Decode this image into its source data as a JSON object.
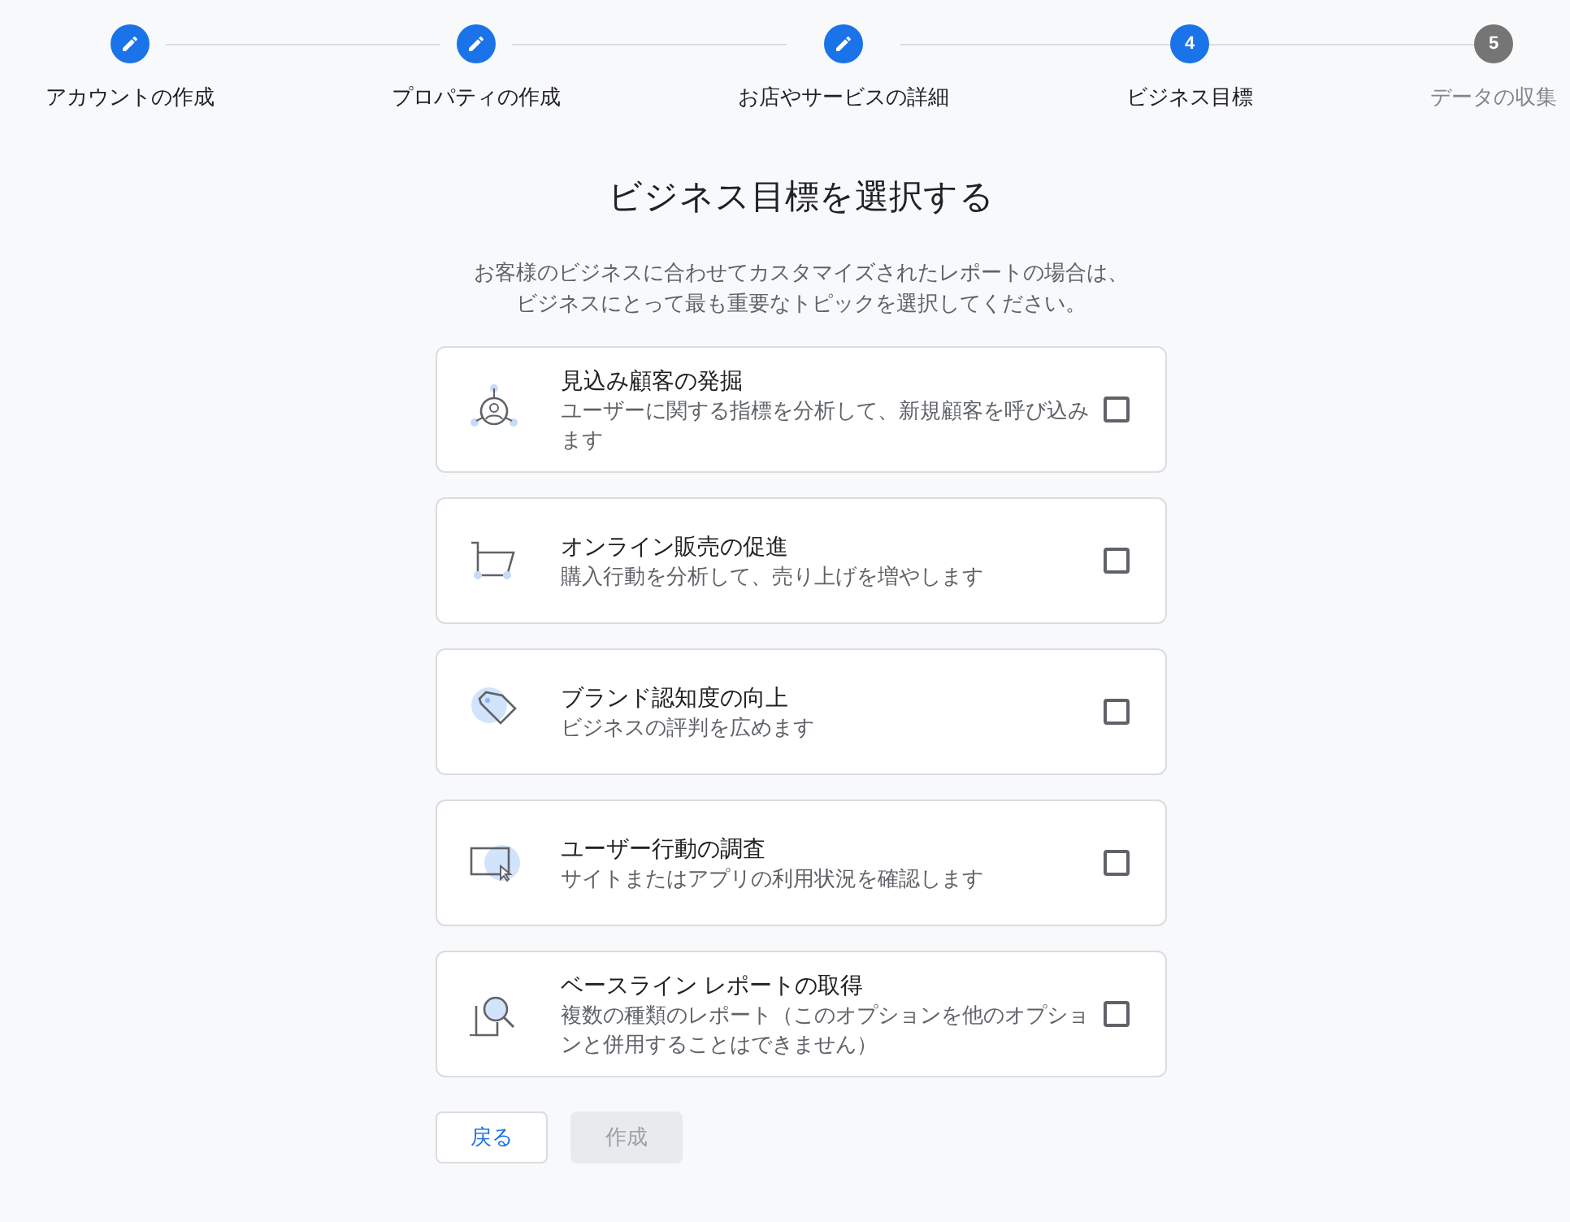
{
  "steps": [
    {
      "label": "アカウントの作成",
      "kind": "done"
    },
    {
      "label": "プロパティの作成",
      "kind": "done"
    },
    {
      "label": "お店やサービスの詳細",
      "kind": "done"
    },
    {
      "label": "ビジネス目標",
      "kind": "current",
      "number": "4"
    },
    {
      "label": "データの収集",
      "kind": "upcoming",
      "number": "5"
    }
  ],
  "heading": "ビジネス目標を選択する",
  "description": [
    "お客様のビジネスに合わせてカスタマイズされたレポートの場合は、",
    "ビジネスにとって最も重要なトピックを選択してください。"
  ],
  "options": [
    {
      "kind": "leads",
      "title": "見込み顧客の発掘",
      "subtitle": "ユーザーに関する指標を分析して、新規顧客を呼び込みます",
      "checked": false
    },
    {
      "kind": "sales",
      "title": "オンライン販売の促進",
      "subtitle": "購入行動を分析して、売り上げを増やします",
      "checked": false
    },
    {
      "kind": "brand",
      "title": "ブランド認知度の向上",
      "subtitle": "ビジネスの評判を広めます",
      "checked": false
    },
    {
      "kind": "behavior",
      "title": "ユーザー行動の調査",
      "subtitle": "サイトまたはアプリの利用状況を確認します",
      "checked": false
    },
    {
      "kind": "baseline",
      "title": "ベースライン レポートの取得",
      "subtitle": "複数の種類のレポート（このオプションを他のオプションと併用することはできません）",
      "checked": false
    }
  ],
  "buttons": [
    {
      "label": "戻る",
      "disabled": false
    },
    {
      "label": "作成",
      "disabled": true
    }
  ]
}
